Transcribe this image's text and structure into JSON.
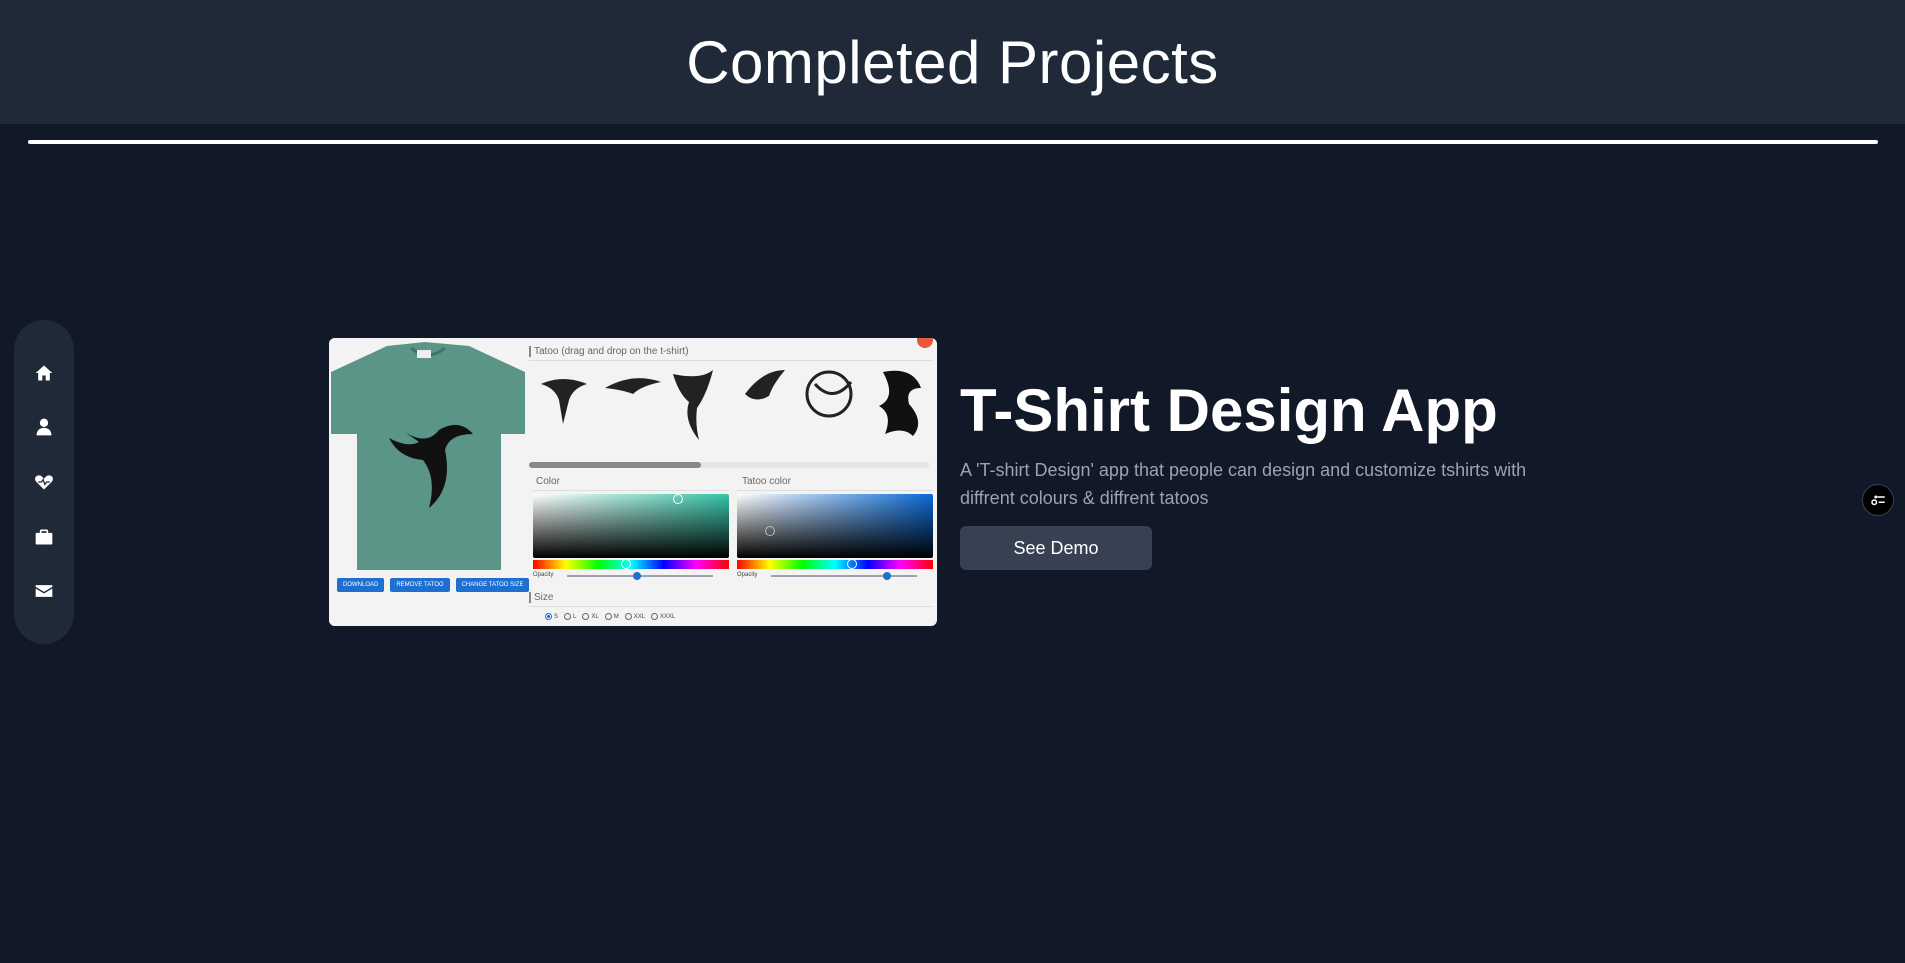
{
  "header": {
    "title": "Completed Projects"
  },
  "sidebar": {
    "items": [
      {
        "name": "home",
        "icon": "home-icon"
      },
      {
        "name": "about",
        "icon": "user-icon"
      },
      {
        "name": "skills",
        "icon": "heart-icon"
      },
      {
        "name": "projects",
        "icon": "briefcase-icon"
      },
      {
        "name": "contact",
        "icon": "envelope-icon"
      }
    ]
  },
  "project": {
    "title": "T-Shirt Design App",
    "description": "A 'T-shirt Design' app that people can design and customize tshirts with diffrent colours & diffrent tatoos",
    "demo_label": "See Demo",
    "screenshot": {
      "tattoo_section": "Tatoo (drag and drop on the t-shirt)",
      "color_section": "Color",
      "tattoo_color_section": "Tatoo color",
      "opacity_label": "Opacity",
      "size_section": "Size",
      "buttons": [
        "DOWNLOAD",
        "REMOVE TATOO",
        "CHANGE TATOO SIZE"
      ],
      "sizes": [
        "S",
        "L",
        "XL",
        "M",
        "XXL",
        "XXXL"
      ],
      "shirt_color": "#5a9588"
    }
  },
  "colors": {
    "background": "#111827",
    "header_bg": "#1f2937",
    "button_bg": "#374151",
    "muted_text": "#9ca3af"
  },
  "floating_widget": {
    "icon": "settings-toggle-icon"
  }
}
